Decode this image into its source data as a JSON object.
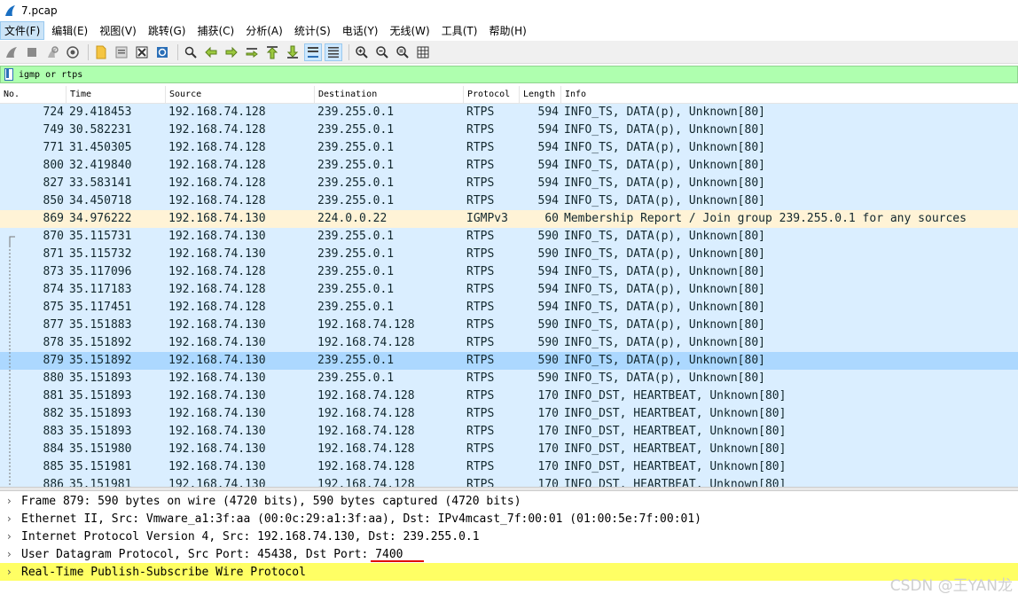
{
  "window": {
    "title": "7.pcap"
  },
  "menu": [
    "文件(F)",
    "编辑(E)",
    "视图(V)",
    "跳转(G)",
    "捕获(C)",
    "分析(A)",
    "统计(S)",
    "电话(Y)",
    "无线(W)",
    "工具(T)",
    "帮助(H)"
  ],
  "filter": {
    "value": "igmp or rtps"
  },
  "columns": {
    "no": "No.",
    "time": "Time",
    "source": "Source",
    "destination": "Destination",
    "protocol": "Protocol",
    "length": "Length",
    "info": "Info"
  },
  "packets": [
    {
      "no": "724",
      "time": "29.418453",
      "src": "192.168.74.128",
      "dst": "239.255.0.1",
      "proto": "RTPS",
      "len": "594",
      "info": "INFO_TS, DATA(p), Unknown[80]"
    },
    {
      "no": "749",
      "time": "30.582231",
      "src": "192.168.74.128",
      "dst": "239.255.0.1",
      "proto": "RTPS",
      "len": "594",
      "info": "INFO_TS, DATA(p), Unknown[80]"
    },
    {
      "no": "771",
      "time": "31.450305",
      "src": "192.168.74.128",
      "dst": "239.255.0.1",
      "proto": "RTPS",
      "len": "594",
      "info": "INFO_TS, DATA(p), Unknown[80]"
    },
    {
      "no": "800",
      "time": "32.419840",
      "src": "192.168.74.128",
      "dst": "239.255.0.1",
      "proto": "RTPS",
      "len": "594",
      "info": "INFO_TS, DATA(p), Unknown[80]"
    },
    {
      "no": "827",
      "time": "33.583141",
      "src": "192.168.74.128",
      "dst": "239.255.0.1",
      "proto": "RTPS",
      "len": "594",
      "info": "INFO_TS, DATA(p), Unknown[80]"
    },
    {
      "no": "850",
      "time": "34.450718",
      "src": "192.168.74.128",
      "dst": "239.255.0.1",
      "proto": "RTPS",
      "len": "594",
      "info": "INFO_TS, DATA(p), Unknown[80]"
    },
    {
      "no": "869",
      "time": "34.976222",
      "src": "192.168.74.130",
      "dst": "224.0.0.22",
      "proto": "IGMPv3",
      "len": "60",
      "info": "Membership Report / Join group 239.255.0.1 for any sources"
    },
    {
      "no": "870",
      "time": "35.115731",
      "src": "192.168.74.130",
      "dst": "239.255.0.1",
      "proto": "RTPS",
      "len": "590",
      "info": "INFO_TS, DATA(p), Unknown[80]"
    },
    {
      "no": "871",
      "time": "35.115732",
      "src": "192.168.74.130",
      "dst": "239.255.0.1",
      "proto": "RTPS",
      "len": "590",
      "info": "INFO_TS, DATA(p), Unknown[80]"
    },
    {
      "no": "873",
      "time": "35.117096",
      "src": "192.168.74.128",
      "dst": "239.255.0.1",
      "proto": "RTPS",
      "len": "594",
      "info": "INFO_TS, DATA(p), Unknown[80]"
    },
    {
      "no": "874",
      "time": "35.117183",
      "src": "192.168.74.128",
      "dst": "239.255.0.1",
      "proto": "RTPS",
      "len": "594",
      "info": "INFO_TS, DATA(p), Unknown[80]"
    },
    {
      "no": "875",
      "time": "35.117451",
      "src": "192.168.74.128",
      "dst": "239.255.0.1",
      "proto": "RTPS",
      "len": "594",
      "info": "INFO_TS, DATA(p), Unknown[80]"
    },
    {
      "no": "877",
      "time": "35.151883",
      "src": "192.168.74.130",
      "dst": "192.168.74.128",
      "proto": "RTPS",
      "len": "590",
      "info": "INFO_TS, DATA(p), Unknown[80]"
    },
    {
      "no": "878",
      "time": "35.151892",
      "src": "192.168.74.130",
      "dst": "192.168.74.128",
      "proto": "RTPS",
      "len": "590",
      "info": "INFO_TS, DATA(p), Unknown[80]"
    },
    {
      "no": "879",
      "time": "35.151892",
      "src": "192.168.74.130",
      "dst": "239.255.0.1",
      "proto": "RTPS",
      "len": "590",
      "info": "INFO_TS, DATA(p), Unknown[80]"
    },
    {
      "no": "880",
      "time": "35.151893",
      "src": "192.168.74.130",
      "dst": "239.255.0.1",
      "proto": "RTPS",
      "len": "590",
      "info": "INFO_TS, DATA(p), Unknown[80]"
    },
    {
      "no": "881",
      "time": "35.151893",
      "src": "192.168.74.130",
      "dst": "192.168.74.128",
      "proto": "RTPS",
      "len": "170",
      "info": "INFO_DST, HEARTBEAT, Unknown[80]"
    },
    {
      "no": "882",
      "time": "35.151893",
      "src": "192.168.74.130",
      "dst": "192.168.74.128",
      "proto": "RTPS",
      "len": "170",
      "info": "INFO_DST, HEARTBEAT, Unknown[80]"
    },
    {
      "no": "883",
      "time": "35.151893",
      "src": "192.168.74.130",
      "dst": "192.168.74.128",
      "proto": "RTPS",
      "len": "170",
      "info": "INFO_DST, HEARTBEAT, Unknown[80]"
    },
    {
      "no": "884",
      "time": "35.151980",
      "src": "192.168.74.130",
      "dst": "192.168.74.128",
      "proto": "RTPS",
      "len": "170",
      "info": "INFO_DST, HEARTBEAT, Unknown[80]"
    },
    {
      "no": "885",
      "time": "35.151981",
      "src": "192.168.74.130",
      "dst": "192.168.74.128",
      "proto": "RTPS",
      "len": "170",
      "info": "INFO_DST, HEARTBEAT, Unknown[80]"
    },
    {
      "no": "886",
      "time": "35.151981",
      "src": "192.168.74.130",
      "dst": "192.168.74.128",
      "proto": "RTPS",
      "len": "170",
      "info": "INFO_DST, HEARTBEAT, Unknown[80]"
    }
  ],
  "selected_no": "879",
  "details": [
    "Frame 879: 590 bytes on wire (4720 bits), 590 bytes captured (4720 bits)",
    "Ethernet II, Src: Vmware_a1:3f:aa (00:0c:29:a1:3f:aa), Dst: IPv4mcast_7f:00:01 (01:00:5e:7f:00:01)",
    "Internet Protocol Version 4, Src: 192.168.74.130, Dst: 239.255.0.1",
    "User Datagram Protocol, Src Port: 45438, Dst Port: 7400",
    "Real-Time Publish-Subscribe Wire Protocol"
  ],
  "watermark": "CSDN @王YAN龙",
  "colors": {
    "rtps_row": "#daeeff",
    "igmp_row": "#fff3d6",
    "selected_row": "#acd8ff",
    "filter_bg": "#afffaf",
    "highlight": "#ffff64",
    "underline": "#e00000"
  },
  "toolbar_icons": [
    "shark-start-icon",
    "stop-icon",
    "restart-icon",
    "options-gear-icon",
    "open-file-icon",
    "open-recent-icon",
    "close-file-icon",
    "reload-icon",
    "find-icon",
    "back-arrow-icon",
    "forward-arrow-icon",
    "goto-packet-icon",
    "first-packet-icon",
    "last-packet-icon",
    "autoscroll-icon",
    "colorize-icon",
    "zoom-in-icon",
    "zoom-out-icon",
    "zoom-normal-icon",
    "resize-columns-icon"
  ]
}
